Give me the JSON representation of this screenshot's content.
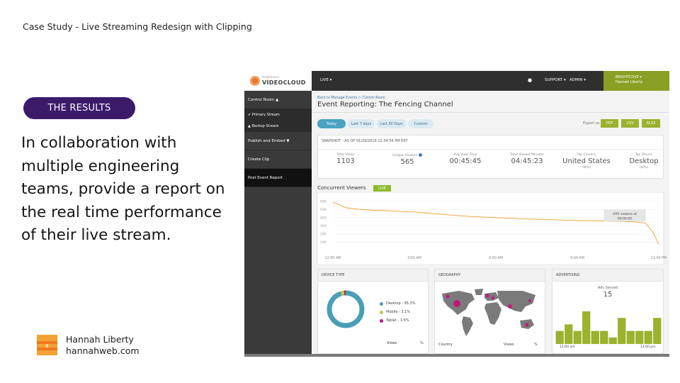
{
  "slide": {
    "case_title": "Case Study - Live Streaming Redesign with Clipping",
    "section_pill": "THE RESULTS",
    "headline": "In collaboration with multiple engineering teams, provide a report on the real time performance of their live stream.",
    "author_name": "Hannah Liberty",
    "author_site": "hannahweb.com",
    "logo_colors": [
      "#f4a233",
      "#ef7a1f"
    ]
  },
  "app": {
    "brand_small": "brightcove",
    "brand_name": "VIDEOCLOUD",
    "nav_live": "LIVE ▾",
    "nav_support": "SUPPORT ▾",
    "nav_admin": "ADMIN ▾",
    "account_company": "BRIGHTCOVE ▾",
    "account_user": "Hannah Liberty",
    "accent_color": "#8aa025"
  },
  "sidebar": {
    "control_room": "Control Room ▲",
    "primary_stream": "Primary Stream",
    "backup_stream": "Backup Stream",
    "publish_embed": "Publish and Embed ▼",
    "create_clip": "Create Clip",
    "post_event_report": "Post Event Report"
  },
  "main": {
    "breadcrumb": "Back to Manage Events > Control Room",
    "title": "Event Reporting: The Fencing Channel",
    "tabs": [
      "Today",
      "Last 7 days",
      "Last 30 Days",
      "Custom"
    ],
    "export_label": "Export as",
    "export_buttons": [
      "PDF",
      "CSV",
      "XLSX"
    ]
  },
  "snapshot": {
    "label": "SNAPSHOT - AS OF 01/29/2019  12:34:56 PM EST",
    "metrics": [
      {
        "label": "Total Views",
        "value": "1103",
        "sub": ""
      },
      {
        "label": "Unique Viewers",
        "value": "565",
        "sub": ""
      },
      {
        "label": "Avg View Time",
        "value": "00:45:45",
        "sub": ""
      },
      {
        "label": "Total Viewed Minutes",
        "value": "04:45:23",
        "sub": ""
      },
      {
        "label": "Top Country",
        "value": "United States",
        "sub": "(90%)"
      },
      {
        "label": "Top Device",
        "value": "Desktop",
        "sub": "(90%)"
      }
    ]
  },
  "concurrent": {
    "title": "Concurrent Viewers",
    "badge": "LIVE",
    "tooltip_line1": "XXX viewers at",
    "tooltip_line2": "00:00:00"
  },
  "chart_data": {
    "type": "line",
    "title": "Concurrent Viewers",
    "xlabel": "",
    "ylabel": "",
    "x_tick_labels": [
      "12:00 AM",
      "3:00 AM",
      "6:00 AM",
      "9:00 AM",
      "12:00 PM"
    ],
    "y_ticks": [
      100,
      200,
      300,
      400,
      500,
      600
    ],
    "ylim": [
      0,
      650
    ],
    "xlim": [
      0,
      12
    ],
    "grid": true,
    "series": [
      {
        "color": "#f0a030",
        "x": [
          0,
          0.5,
          1,
          1.5,
          2,
          2.5,
          3,
          3.5,
          4,
          5,
          6,
          7,
          8,
          9,
          10,
          10.5,
          11,
          11.5,
          11.8,
          12
        ],
        "y": [
          590,
          520,
          500,
          490,
          485,
          475,
          470,
          455,
          440,
          415,
          400,
          385,
          375,
          365,
          360,
          355,
          350,
          335,
          220,
          70
        ]
      }
    ]
  },
  "panels": {
    "device": {
      "title": "DEVICE TYPE",
      "legend": [
        {
          "label": "Desktop - 95.3%",
          "value": 95.3,
          "color": "#4a9fb5"
        },
        {
          "label": "Mobile - 3.1%",
          "value": 3.1,
          "color": "#b9c84a"
        },
        {
          "label": "Tablet - 1.6%",
          "value": 1.6,
          "color": "#c2187a"
        }
      ],
      "col_views": "Views",
      "col_pct": "%"
    },
    "geo": {
      "title": "GEOGRAPHY",
      "col_country": "Country",
      "col_views": "Views",
      "col_pct": "%"
    },
    "ads": {
      "title": "ADVERTISING",
      "label": "Ads Served",
      "value": "15",
      "x_start": "12:00 am",
      "x_end": "12:00 pm",
      "bars": [
        2,
        3,
        2,
        5,
        2,
        2,
        1,
        4,
        2,
        2,
        2,
        4
      ],
      "bar_color": "#9ab22e"
    }
  }
}
